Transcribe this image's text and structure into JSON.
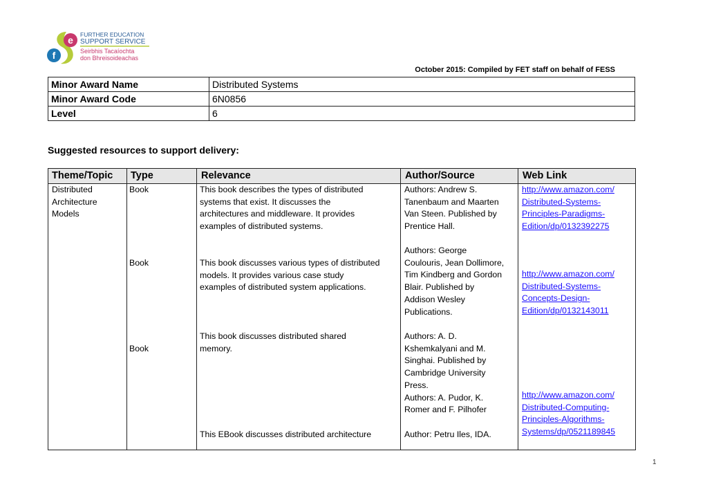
{
  "logo": {
    "line1": "FURTHER EDUCATION",
    "line2": "SUPPORT SERVICE",
    "line3": "Seirbhis Tacaíochta",
    "line4": "don Bhreisoideachas",
    "letter_e": "e",
    "letter_f": "f",
    "colors": {
      "green": "#b6cc3a",
      "pink": "#c8386c",
      "blue": "#1e78b4",
      "navy": "#2a5d96",
      "magenta": "#c73a6e"
    }
  },
  "header_note": "October 2015: Compiled by FET staff on behalf of FESS",
  "award": {
    "rows": [
      {
        "label": "Minor Award Name",
        "value": "Distributed Systems"
      },
      {
        "label": "Minor Award Code",
        "value": "6N0856"
      },
      {
        "label": "Level",
        "value": "6"
      }
    ]
  },
  "section_title": "Suggested resources to support delivery:",
  "resources": {
    "headers": [
      "Theme/Topic",
      "Type",
      "Relevance",
      "Author/Source",
      "Web Link"
    ],
    "header_bg": "#e6e6e6",
    "link_color": "#1a0dff",
    "theme": [
      "Distributed",
      "Architecture",
      "Models"
    ],
    "types": [
      "Book",
      "Book",
      "Book"
    ],
    "relevance": [
      [
        "This book describes the types of distributed",
        "systems that exist. It discusses the",
        "architectures and middleware. It provides",
        "examples of distributed systems."
      ],
      [
        "This book discusses various types of distributed",
        "models. It provides various case study",
        "examples of distributed system applications."
      ],
      [
        "This book discusses distributed shared",
        "memory."
      ],
      [
        "This EBook discusses distributed architecture"
      ]
    ],
    "authors": [
      [
        "Authors: Andrew S.",
        "Tanenbaum and Maarten",
        "Van Steen. Published by",
        "Prentice Hall."
      ],
      [
        "Authors: George",
        "Coulouris, Jean Dollimore,",
        "Tim Kindberg and Gordon",
        "Blair. Published by",
        "Addison Wesley",
        "Publications."
      ],
      [
        "Authors: A. D.",
        "Kshemkalyani and M.",
        "Singhai. Published by",
        "Cambridge University",
        "Press.",
        "Authors: A. Pudor, K.",
        "Romer and F. Pilhofer"
      ],
      [
        "Author: Petru Iles, IDA."
      ]
    ],
    "links": [
      [
        "http://www.amazon.com/",
        "Distributed-Systems-",
        "Principles-Paradigms-",
        "Edition/dp/0132392275"
      ],
      [
        "http://www.amazon.com/",
        "Distributed-Systems-",
        "Concepts-Design-",
        "Edition/dp/0132143011"
      ],
      [
        "http://www.amazon.com/",
        "Distributed-Computing-",
        "Principles-Algorithms-",
        "Systems/dp/0521189845"
      ]
    ]
  },
  "page_number": "1"
}
